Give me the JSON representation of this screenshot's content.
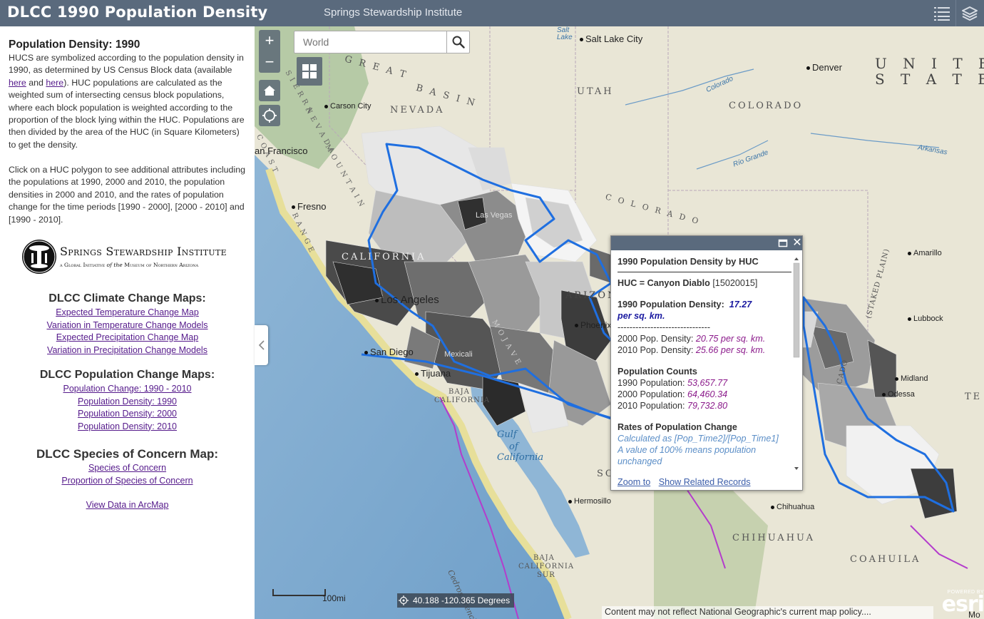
{
  "header": {
    "title": "DLCC 1990 Population Density",
    "subtitle": "Springs Stewardship Institute",
    "list_icon": "list-icon",
    "layers_icon": "layers-icon"
  },
  "sidebar": {
    "panel_title": "Population Density: 1990",
    "desc_part1": "HUCS are symbolized according to the population density in 1990, as determined by US Census Block data (available ",
    "link_here1": "here",
    "desc_and": " and ",
    "link_here2": "here",
    "desc_part2": ").  HUC populations are calculated as the weighted sum of intersecting census block populations, where each block population is weighted according to the proportion of the block lying within the HUC.  Populations are then divided by the area of the HUC (in Square Kilometers) to get the density.",
    "desc2": "Click on a HUC polygon to see additional attributes including the populations at 1990, 2000 and 2010, the population densities in 2000 and 2010, and the rates of population change for the time periods [1990 - 2000], [2000 - 2010] and [1990 - 2010].",
    "logo": {
      "name": "Springs Stewardship Institute",
      "tagline_a": "a Global Initiative",
      "tagline_b": "of the",
      "tagline_c": "Museum of Northern Arizona"
    },
    "sections": [
      {
        "heading": "DLCC Climate Change Maps:",
        "links": [
          "Expected Temperature Change Map",
          "Variation in Temperature Change Models",
          "Expected Precipitation Change Map",
          "Variation in Precipitation Change Models"
        ]
      },
      {
        "heading": "DLCC Population Change Maps:",
        "links": [
          "Population Change: 1990 - 2010",
          "Population Density: 1990",
          "Population Density: 2000",
          "Population Density: 2010"
        ]
      },
      {
        "heading": "DLCC Species of Concern Map:",
        "links": [
          "Species of Concern",
          "Proportion of Species of Concern"
        ]
      }
    ],
    "arcmap_link": "View Data in ArcMap"
  },
  "map": {
    "search_placeholder": "World",
    "zoom_in": "+",
    "zoom_out": "−",
    "labels": {
      "salt_lake_city": "Salt Lake City",
      "denver": "Denver",
      "united_a": "U N I T E",
      "united_b": "S T A T E",
      "great_basin_a": "G R E A T",
      "great_basin_b": "B A S I N",
      "utah": "UTAH",
      "nevada": "NEVADA",
      "colorado_state": "COLORADO",
      "carson_city": "Carson City",
      "san_francisco": "an Francisco",
      "fresno": "Fresno",
      "california": "CALIFORNIA",
      "las_vegas": "Las Vegas",
      "los_angeles": "Los Angeles",
      "san_diego": "San Diego",
      "tijuana": "Tijuana",
      "mexicali": "Mexicali",
      "baja_california_a": "BAJA",
      "baja_california_b": "CALIFORNIA",
      "gulf_a": "Gulf",
      "gulf_b": "of",
      "gulf_c": "California",
      "phoenix": "Phoenix",
      "arizona": "ARIZONA",
      "sonora": "SO",
      "hermosillo": "Hermosillo",
      "chihuahua_city": "Chihuahua",
      "chihuahua_state": "CHIHUAHUA",
      "coahuila": "COAHUILA",
      "baja_sur_a": "BAJA",
      "baja_sur_b": "CALIFORNIA",
      "baja_sur_c": "SUR",
      "amarillo": "Amarillo",
      "lubbock": "Lubbock",
      "midland": "Midland",
      "odessa": "Odessa",
      "texas": "TE",
      "staked_plain": "(STAKED PLAIN)",
      "cado": "CADO",
      "colorado_river": "Colorado",
      "arkansas": "Arkansas",
      "rio_grande": "Río Grande",
      "colorado_plateau": "C O L O R A D O",
      "cedros": "Cedros Trench",
      "lake": "Lake",
      "salt": "Salt",
      "coast_ranges": "C O A S T",
      "sierra": "S I E R R A",
      "nevada_mtn": "N E V A D A",
      "mountain": "M O U N T A I N",
      "range": "R A N G E",
      "mojave": "M O J A V E",
      "mo": "Mo"
    },
    "scale_label": "100mi",
    "coords": "40.188 -120.365 Degrees",
    "attribution": "Content may not reflect National Geographic's current map policy....",
    "esri_powered": "POWERED BY",
    "esri_logo": "esri"
  },
  "popup": {
    "title": "1990 Population Density by HUC",
    "huc_label": "HUC = Canyon Diablo",
    "huc_id": "[15020015]",
    "density_label": "1990 Population Density:",
    "density_value": "17.27",
    "density_unit": "per sq. km.",
    "separator": "-------------------------------",
    "d2000_label": "2000 Pop. Density:",
    "d2000_value": "20.75 per sq. km.",
    "d2010_label": "2010 Pop. Density:",
    "d2010_value": "25.66 per sq. km.",
    "counts_heading": "Population Counts",
    "p1990_label": "1990 Population:",
    "p1990_value": "53,657.77",
    "p2000_label": "2000 Population:",
    "p2000_value": "64,460.34",
    "p2010_label": "2010 Population:",
    "p2010_value": "79,732.80",
    "rates_heading": "Rates of Population Change",
    "rates_note1": "Calculated as [Pop_Time2]/[Pop_Time1]",
    "rates_note2": "A value of 100% means population unchanged",
    "zoom_to": "Zoom to",
    "show_related": "Show Related Records"
  },
  "colors": {
    "header_bg": "#5a6a7d",
    "link": "#551a8b",
    "popup_value": "#8b1a8b",
    "popup_big_value": "#1a1aa0",
    "watershed_outline": "#1f6fe0",
    "border_magenta": "#b43ccc"
  }
}
